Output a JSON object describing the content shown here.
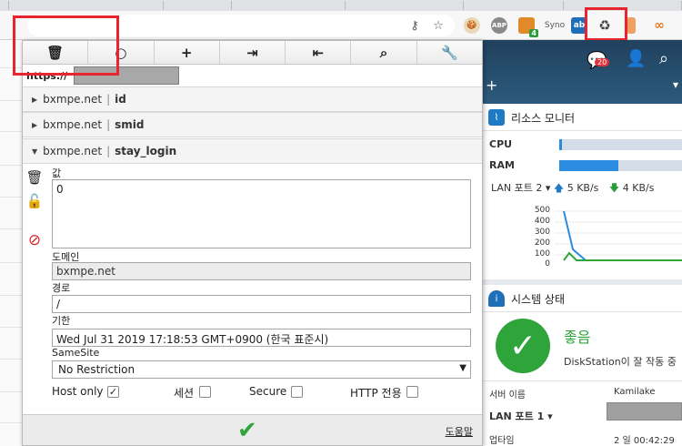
{
  "browser": {
    "url_masked": "https://",
    "extensions": [
      {
        "name": "cookie-extension",
        "label": "🍪"
      },
      {
        "name": "abp-extension",
        "label": "ABP"
      },
      {
        "name": "puzzle-extension",
        "label": "",
        "badge": "4"
      },
      {
        "name": "syno-extension",
        "label": "Syno"
      },
      {
        "name": "blue-extension",
        "label": "ab"
      },
      {
        "name": "recycle-extension",
        "label": "♻"
      },
      {
        "name": "orange-extension",
        "label": ""
      },
      {
        "name": "link-extension",
        "label": ""
      }
    ]
  },
  "popup": {
    "toolbar": [
      {
        "name": "delete-all-icon",
        "glyph": "🗑"
      },
      {
        "name": "refresh-icon",
        "glyph": "○"
      },
      {
        "name": "add-icon",
        "glyph": "+"
      },
      {
        "name": "import-icon",
        "glyph": "⇥"
      },
      {
        "name": "export-icon",
        "glyph": "⇤"
      },
      {
        "name": "search-icon",
        "glyph": "⌕"
      },
      {
        "name": "wrench-icon",
        "glyph": "🔧"
      }
    ],
    "url_prefix": "https://",
    "cookies": [
      {
        "domain": "bxmpe.net",
        "sep": "|",
        "name": "id",
        "expanded": false
      },
      {
        "domain": "bxmpe.net",
        "sep": "|",
        "name": "smid",
        "expanded": false
      },
      {
        "domain": "bxmpe.net",
        "sep": "|",
        "name": "stay_login",
        "expanded": true
      }
    ],
    "editor": {
      "value_label": "값",
      "value": "0",
      "domain_label": "도메인",
      "domain": "bxmpe.net",
      "path_label": "경로",
      "path": "/",
      "expires_label": "기한",
      "expires": "Wed Jul 31 2019 17:18:53 GMT+0900 (한국 표준시)",
      "samesite_label": "SameSite",
      "samesite": "No Restriction",
      "hostonly_label": "Host only",
      "hostonly_checked": true,
      "session_label": "세션",
      "session_checked": false,
      "secure_label": "Secure",
      "secure_checked": false,
      "httponly_label": "HTTP 전용",
      "httponly_checked": false
    },
    "footer": {
      "save_glyph": "✔",
      "help_label": "도움말"
    }
  },
  "dsm": {
    "notification_count": "20",
    "resource_monitor": {
      "title": "리소스 모니터",
      "cpu_label": "CPU",
      "cpu_percent": 2,
      "ram_label": "RAM",
      "ram_percent": 48,
      "lan_label": "LAN 포트 2",
      "lan_caret": "▾",
      "upload": "5 KB/s",
      "download": "4 KB/s",
      "y_ticks": [
        "500",
        "400",
        "300",
        "200",
        "100",
        "0"
      ]
    },
    "system_status": {
      "title": "시스템 상태",
      "state": "좋음",
      "message": "DiskStation이 잘 작동 중",
      "server_name_label": "서버 이름",
      "server_name": "Kamilake",
      "lan_label": "LAN 포트 1",
      "uptime_label": "업타임",
      "uptime": "2 일 00:42:29"
    }
  },
  "colors": {
    "highlight": "#e8242c",
    "ok_green": "#2ea43b",
    "accent_blue": "#2a8be0"
  }
}
